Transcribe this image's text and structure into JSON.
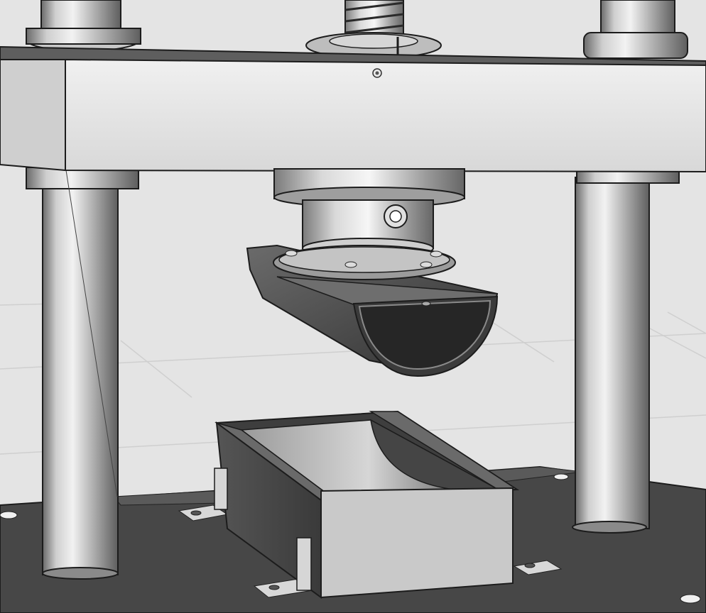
{
  "scene": {
    "kind": "cad-render",
    "colors": {
      "background": "#e4e4e4",
      "floor_line": "#c9c9c9",
      "metal_light": "#e6e6e6",
      "metal_mid": "#b9b9b9",
      "metal_dark": "#5a5a5a",
      "edge": "#1c1c1c",
      "base_plate": "#474747"
    }
  }
}
